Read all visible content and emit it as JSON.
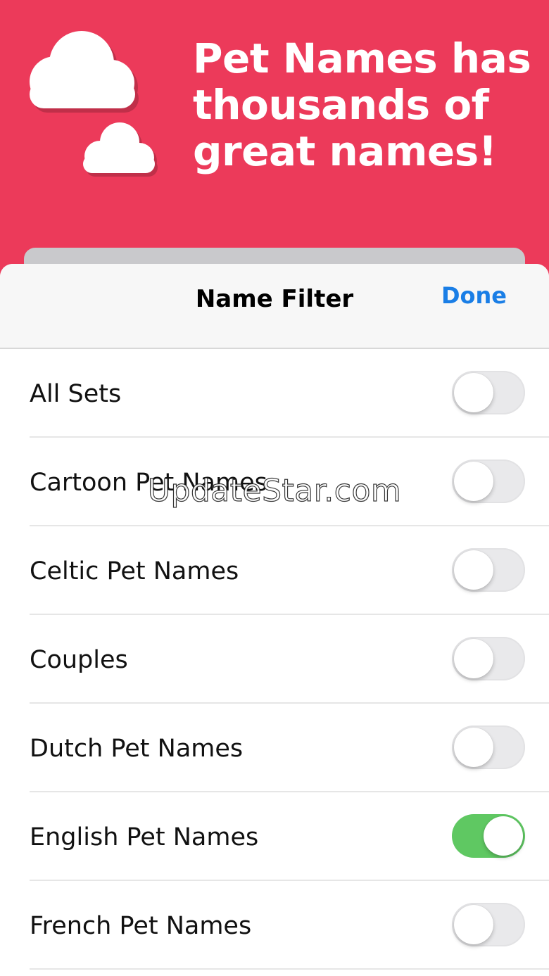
{
  "banner": {
    "headline": "Pet Names has thousands of great names!",
    "cloud_icon": "cloud-icon",
    "background_color": "#ec3a5a"
  },
  "sheet": {
    "title": "Name Filter",
    "done_label": "Done",
    "accent_color": "#1a7ee6",
    "toggle_on_color": "#5fc862"
  },
  "filters": [
    {
      "label": "All Sets",
      "on": false
    },
    {
      "label": "Cartoon Pet Names",
      "on": false
    },
    {
      "label": "Celtic Pet Names",
      "on": false
    },
    {
      "label": "Couples",
      "on": false
    },
    {
      "label": "Dutch Pet Names",
      "on": false
    },
    {
      "label": "English Pet Names",
      "on": true
    },
    {
      "label": "French Pet Names",
      "on": false
    }
  ],
  "watermark": "UpdateStar.com"
}
